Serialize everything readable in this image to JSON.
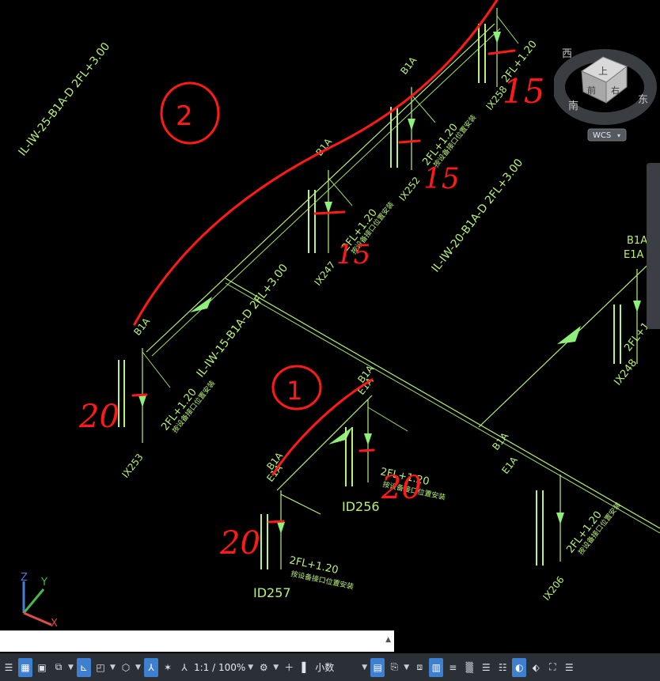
{
  "drawing": {
    "labels": {
      "pipe_25": "IL-IW-25-B1A-D 2FL+3.00",
      "pipe_20": "IL-IW-20-B1A-D 2FL+3.00",
      "pipe_15": "IL-IW-15-B1A-D 2FL+3.00",
      "b1a": "B1A",
      "e1a": "E1A",
      "elev": "2FL+1.20",
      "note": "按设备接口位置安装",
      "tags": [
        "IX258",
        "IX252",
        "IX247",
        "IX253",
        "ID256",
        "ID257",
        "IX206",
        "IX248"
      ]
    },
    "annotations": {
      "circle_2": "2",
      "circle_1": "1",
      "num_15": "15",
      "num_15b": "15",
      "num_15c": "15",
      "num_20a": "20",
      "num_20b": "20",
      "num_20c": "20"
    }
  },
  "viewcube": {
    "face": "上",
    "front": "前",
    "right": "右",
    "west": "西",
    "south": "南",
    "east": "东",
    "wcs": "WCS"
  },
  "ucs": {
    "z": "Z",
    "y": "Y",
    "x": "X"
  },
  "statusbar": {
    "scale": "1:1 / 100%",
    "units": "小数"
  },
  "colors": {
    "cad_line": "#b8f07a",
    "annotation": "#ff1a1a",
    "status_bg": "#2b2f36",
    "active": "#3f7fcf"
  }
}
